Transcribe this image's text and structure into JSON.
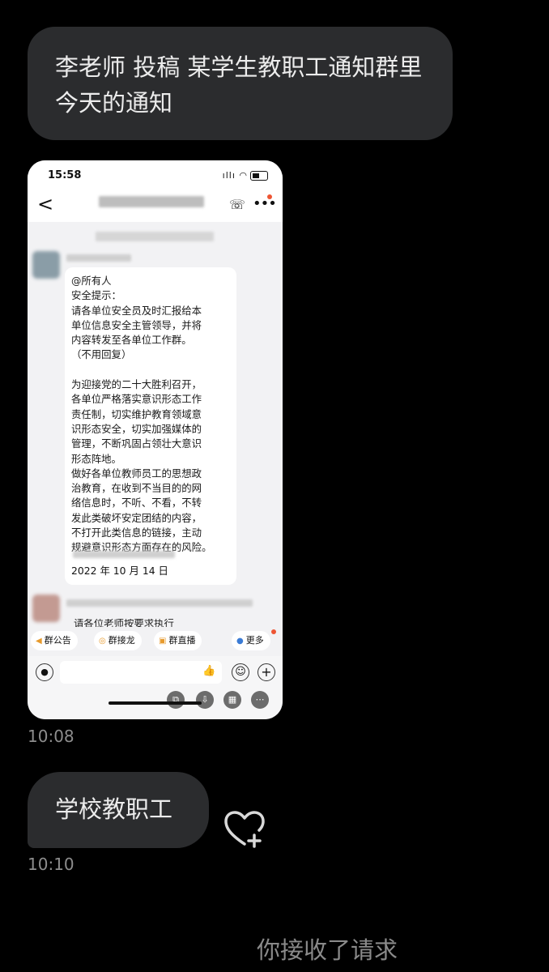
{
  "messages": {
    "first_bubble": "李老师 投稿 某学生教职工通知群里今天的通知",
    "first_time": "10:08",
    "second_bubble": "学校教职工",
    "second_time": "10:10",
    "system_notice": "你接收了请求"
  },
  "screenshot": {
    "status_time": "15:58",
    "signal_icons": "ıllı ◠",
    "back_glyph": "<",
    "message_text": "@所有人\n安全提示：\n请各单位安全员及时汇报给本\n单位信息安全主管领导，并将\n内容转发至各单位工作群。\n（不用回复）\n\n为迎接党的二十大胜利召开，\n各单位严格落实意识形态工作\n责任制，切实维护教育领域意\n识形态安全，切实加强媒体的\n管理，不断巩固占领壮大意识\n形态阵地。\n做好各单位教师员工的思想政\n治教育，在收到不当目的的网\n络信息时，不听、不看，不转\n发此类破坏安定团结的内容，\n不打开此类信息的链接，主动\n规避意识形态方面存在的风险。",
    "message_date": "2022 年 10 月 14 日",
    "second_message_preview": "请各位老师按要求执行",
    "toolbar": [
      "群公告",
      "群接龙",
      "群直播",
      "更多"
    ],
    "toolbar_icons": [
      "megaphone-icon",
      "relay-icon",
      "live-icon",
      "more-apps-icon"
    ]
  },
  "colors": {
    "background": "#000000",
    "bubble": "#2b2c2e",
    "timestamp": "#8d8d8d"
  }
}
